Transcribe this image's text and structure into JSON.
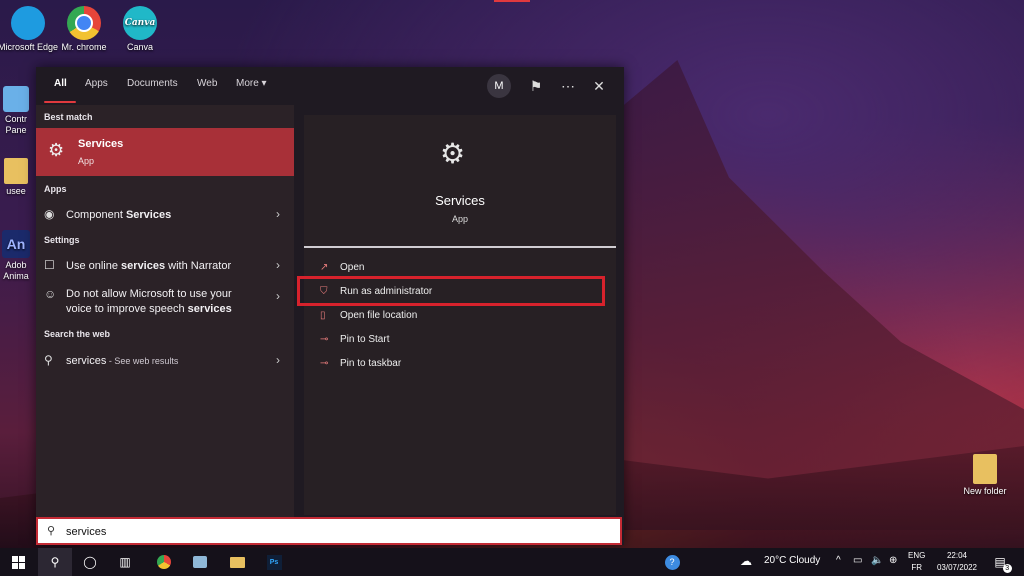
{
  "desktop": {
    "icons": [
      {
        "label": "Microsoft Edge",
        "icon": "edge-icon",
        "color": "#1e9be0"
      },
      {
        "label": "Mr. chrome",
        "icon": "chrome-icon",
        "color": "#e6453a"
      },
      {
        "label": "Canva",
        "icon": "canva-icon",
        "color": "#20b8c8"
      },
      {
        "label": "Contr Pane",
        "icon": "control-panel-icon"
      },
      {
        "label": "usee",
        "icon": "folder-icon"
      },
      {
        "label": "Adob Anima",
        "icon": "adobe-animate-icon",
        "color": "#1b2a6b",
        "glyph_text": "An"
      },
      {
        "label": "New folder",
        "icon": "folder-icon"
      }
    ]
  },
  "search": {
    "tabs": [
      {
        "label": "All",
        "active": true
      },
      {
        "label": "Apps"
      },
      {
        "label": "Documents"
      },
      {
        "label": "Web"
      },
      {
        "label": "More ▾"
      }
    ],
    "user_initial": "M",
    "query": "services",
    "best_match": {
      "heading": "Best match",
      "name": "Services",
      "type": "App"
    },
    "apps": {
      "heading": "Apps",
      "items": [
        {
          "prefix": "Component ",
          "bold": "Services"
        }
      ]
    },
    "settings": {
      "heading": "Settings",
      "items": [
        {
          "prefix": "Use online ",
          "bold": "services",
          "suffix": " with Narrator"
        },
        {
          "line1": "Do not allow Microsoft to use your",
          "prefix": "voice to improve speech ",
          "bold": "services"
        }
      ]
    },
    "web": {
      "heading": "Search the web",
      "query": "services",
      "hint": " - See web results"
    },
    "detail": {
      "name": "Services",
      "type": "App",
      "actions": [
        {
          "label": "Open",
          "icon": "open-icon"
        },
        {
          "label": "Run as administrator",
          "icon": "shield-icon",
          "highlighted": true
        },
        {
          "label": "Open file location",
          "icon": "file-location-icon"
        },
        {
          "label": "Pin to Start",
          "icon": "pin-icon"
        },
        {
          "label": "Pin to taskbar",
          "icon": "pin-icon"
        }
      ]
    }
  },
  "taskbar": {
    "weather": "20°C  Cloudy",
    "lang_top": "ENG",
    "lang_bottom": "FR",
    "time": "22:04",
    "date": "03/07/2022",
    "notifications": "3"
  },
  "colors": {
    "accent": "#e0393e",
    "best_match_bg": "#a83038",
    "highlight_box": "#d7222c"
  }
}
